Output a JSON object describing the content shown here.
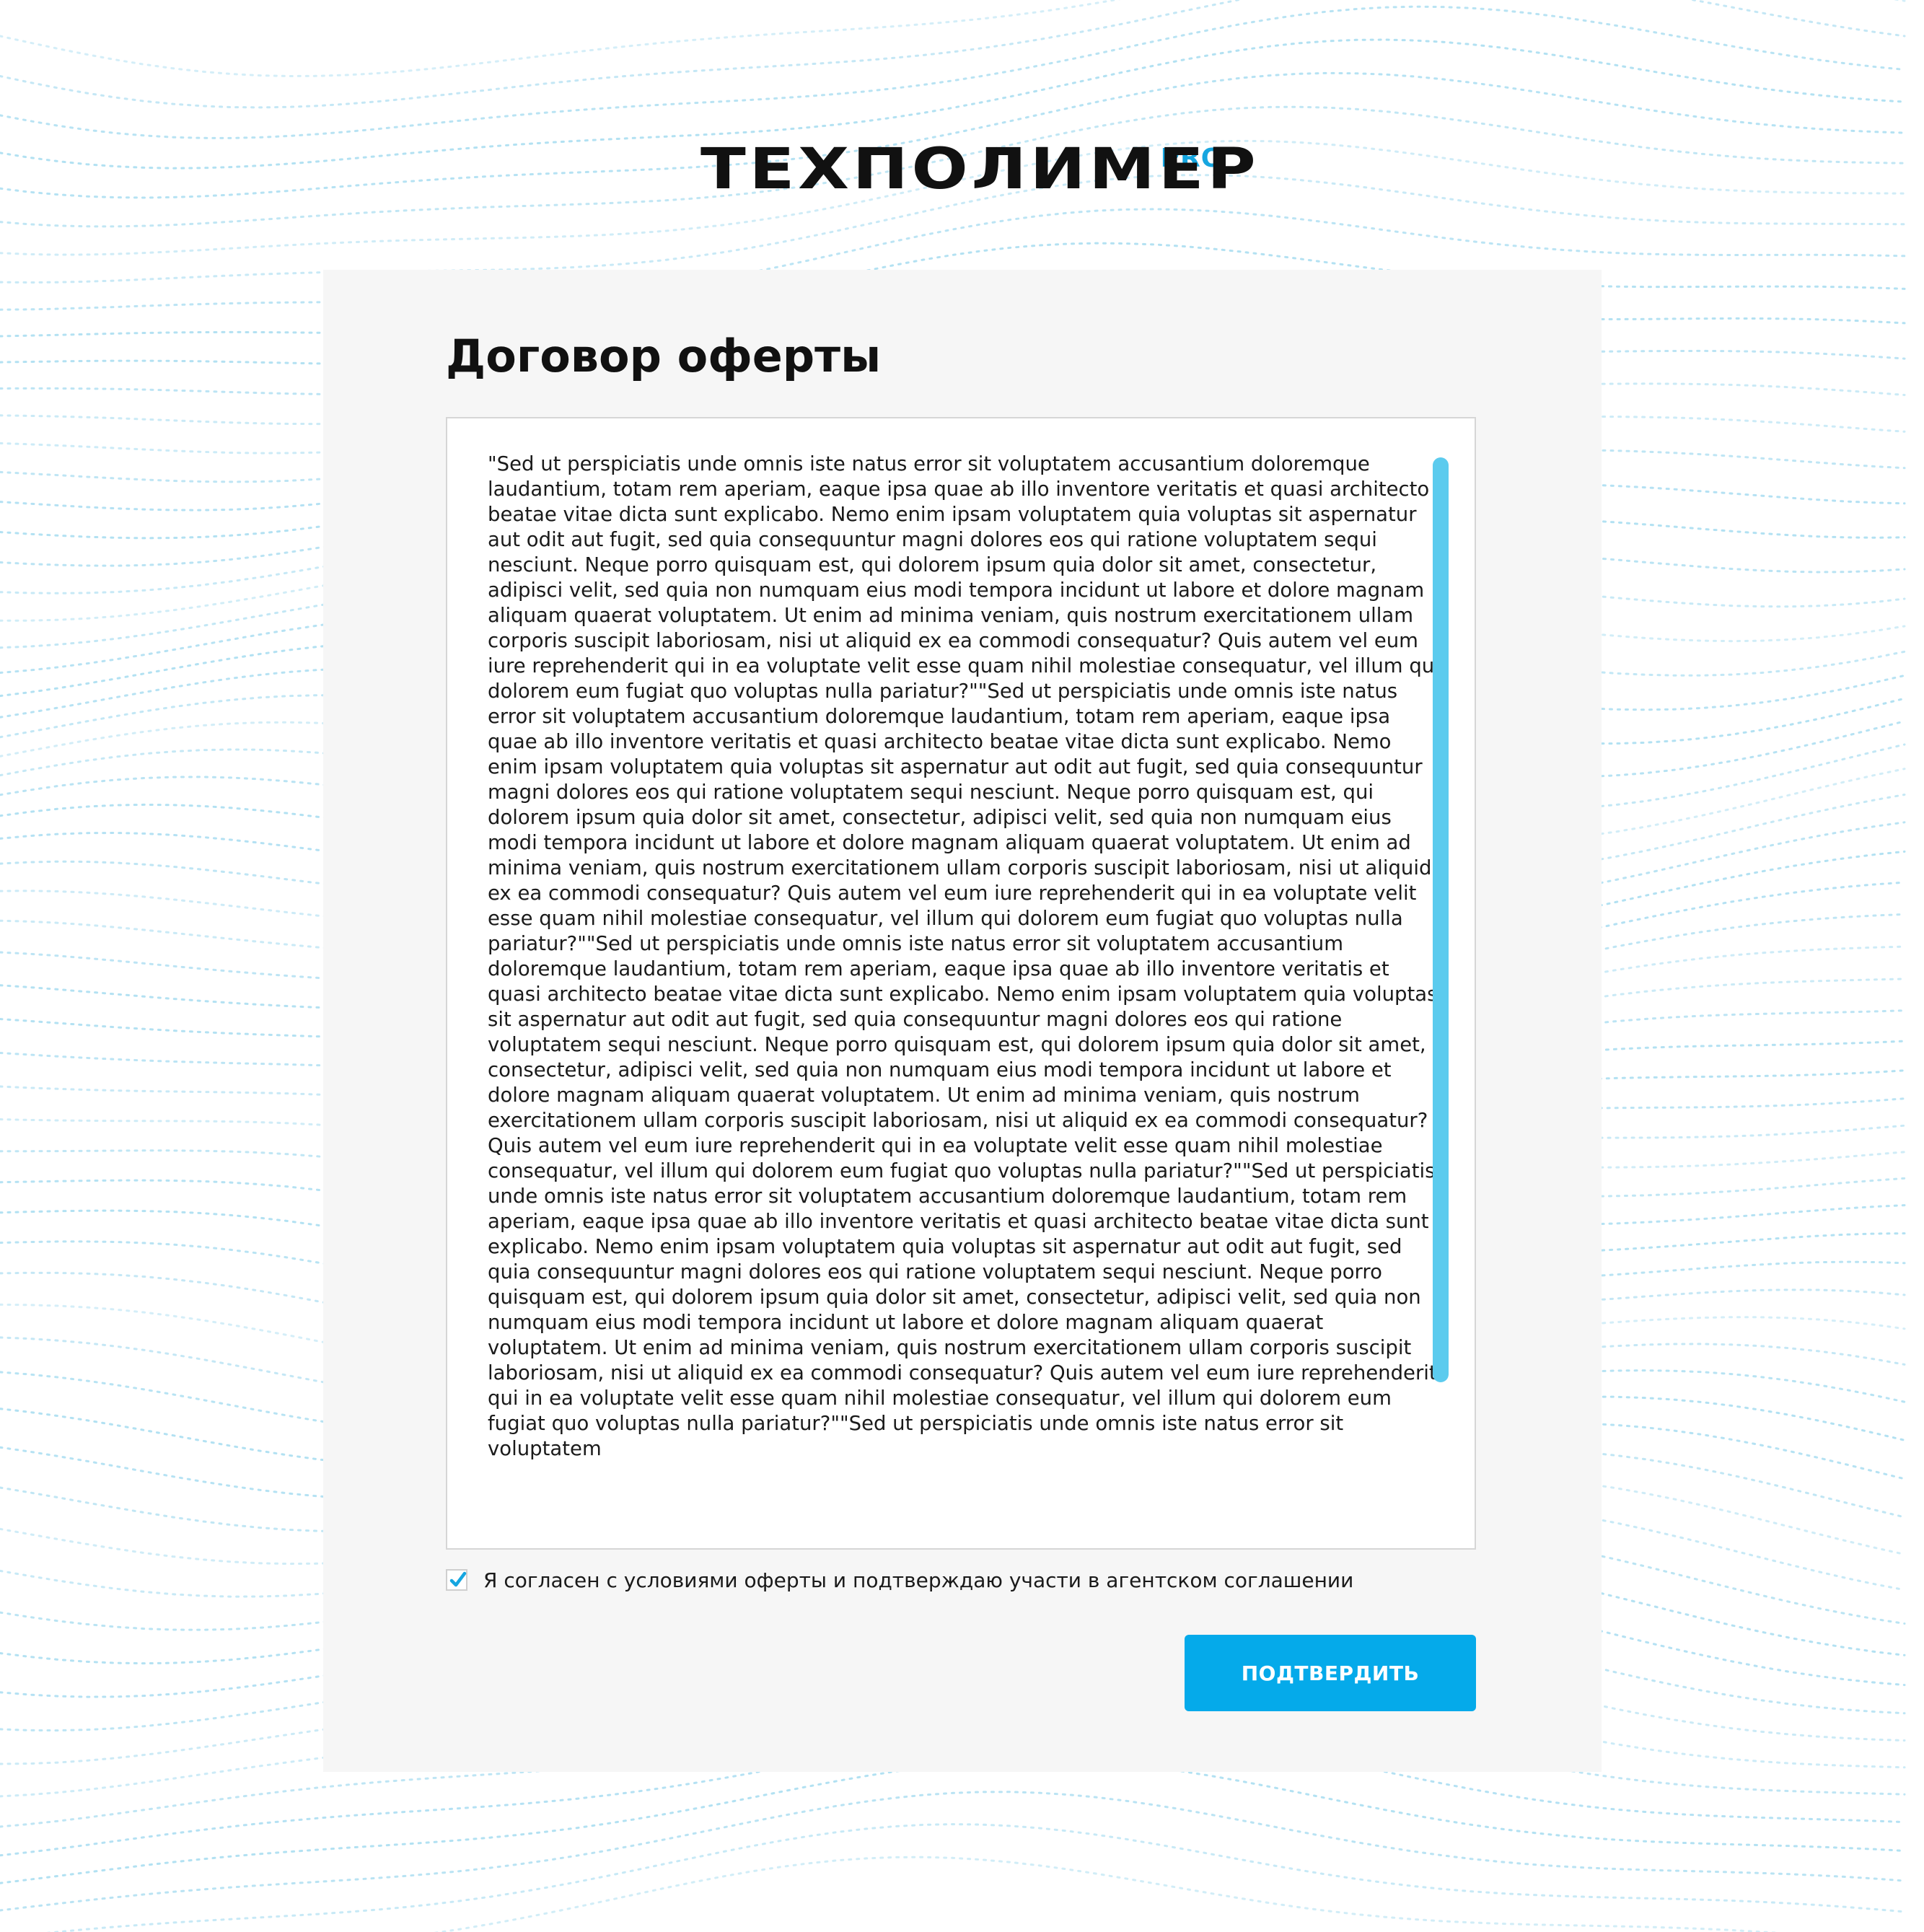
{
  "logo": {
    "text": "ТЕХПОЛИМЕР",
    "badge": "PRO"
  },
  "title": "Договор оферты",
  "document": {
    "text": "\"Sed ut perspiciatis unde omnis iste natus error sit voluptatem accusantium doloremque laudantium, totam rem aperiam, eaque ipsa quae ab illo inventore veritatis et quasi architecto beatae vitae dicta sunt explicabo. Nemo enim ipsam voluptatem quia voluptas sit aspernatur aut odit aut fugit, sed quia consequuntur magni dolores eos qui ratione voluptatem sequi nesciunt. Neque porro quisquam est, qui dolorem ipsum quia dolor sit amet, consectetur, adipisci velit, sed quia non numquam eius modi tempora incidunt ut labore et dolore magnam aliquam quaerat voluptatem. Ut enim ad minima veniam, quis nostrum exercitationem ullam corporis suscipit laboriosam, nisi ut aliquid ex ea commodi consequatur? Quis autem vel eum iure reprehenderit qui in ea voluptate velit esse quam nihil molestiae consequatur, vel illum qui dolorem eum fugiat quo voluptas nulla pariatur?\"\"Sed ut perspiciatis unde omnis iste natus error sit voluptatem accusantium doloremque laudantium, totam rem aperiam, eaque ipsa quae ab illo inventore veritatis et quasi architecto beatae vitae dicta sunt explicabo. Nemo enim ipsam voluptatem quia voluptas sit aspernatur aut odit aut fugit, sed quia consequuntur magni dolores eos qui ratione voluptatem sequi nesciunt. Neque porro quisquam est, qui dolorem ipsum quia dolor sit amet, consectetur, adipisci velit, sed quia non numquam eius modi tempora incidunt ut labore et dolore magnam aliquam quaerat voluptatem. Ut enim ad minima veniam, quis nostrum exercitationem ullam corporis suscipit laboriosam, nisi ut aliquid ex ea commodi consequatur? Quis autem vel eum iure reprehenderit qui in ea voluptate velit esse quam nihil molestiae consequatur, vel illum qui dolorem eum fugiat quo voluptas nulla pariatur?\"\"Sed ut perspiciatis unde omnis iste natus error sit voluptatem accusantium doloremque laudantium, totam rem aperiam, eaque ipsa quae ab illo inventore veritatis et quasi architecto beatae vitae dicta sunt explicabo. Nemo enim ipsam voluptatem quia voluptas sit aspernatur aut odit aut fugit, sed quia consequuntur magni dolores eos qui ratione voluptatem sequi nesciunt. Neque porro quisquam est, qui dolorem ipsum quia dolor sit amet, consectetur, adipisci velit, sed quia non numquam eius modi tempora incidunt ut labore et dolore magnam aliquam quaerat voluptatem. Ut enim ad minima veniam, quis nostrum exercitationem ullam corporis suscipit laboriosam, nisi ut aliquid ex ea commodi consequatur? Quis autem vel eum iure reprehenderit qui in ea voluptate velit esse quam nihil molestiae consequatur, vel illum qui dolorem eum fugiat quo voluptas nulla pariatur?\"\"Sed ut perspiciatis unde omnis iste natus error sit voluptatem accusantium doloremque laudantium, totam rem aperiam, eaque ipsa quae ab illo inventore veritatis et quasi architecto beatae vitae dicta sunt explicabo. Nemo enim ipsam voluptatem quia voluptas sit aspernatur aut odit aut fugit, sed quia consequuntur magni dolores eos qui ratione voluptatem sequi nesciunt. Neque porro quisquam est, qui dolorem ipsum quia dolor sit amet, consectetur, adipisci velit, sed quia non numquam eius modi tempora incidunt ut labore et dolore magnam aliquam quaerat voluptatem. Ut enim ad minima veniam, quis nostrum exercitationem ullam corporis suscipit laboriosam, nisi ut aliquid ex ea commodi consequatur? Quis autem vel eum iure reprehenderit qui in ea voluptate velit esse quam nihil molestiae consequatur, vel illum qui dolorem eum fugiat quo voluptas nulla pariatur?\"\"Sed ut perspiciatis unde omnis iste natus error sit voluptatem"
  },
  "agreement": {
    "checked": true,
    "label": "Я согласен с условиями оферты и подтверждаю участи в агентском соглашении"
  },
  "confirm_button": {
    "label": "ПОДТВЕРДИТЬ"
  },
  "colors": {
    "accent": "#05aaea",
    "scrollbar": "#5ccbee",
    "check": "#16a6e0",
    "card_bg": "#f6f6f6",
    "wave": "#9fd9ef"
  },
  "icons": {
    "checkbox": "checkmark-icon"
  }
}
